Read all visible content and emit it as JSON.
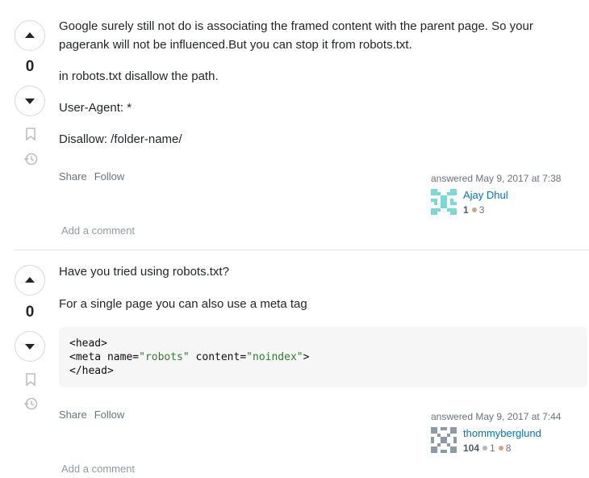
{
  "answers": [
    {
      "vote_count": "0",
      "paragraphs": [
        "Google surely still not do is associating the framed content with the parent page. So your",
        "pagerank will not be influenced.But you can stop it from robots.txt.",
        "in robots.txt disallow the path.",
        "User-Agent: *",
        "Disallow: /folder-name/"
      ],
      "share_label": "Share",
      "follow_label": "Follow",
      "answered_text": "answered May 9, 2017 at 7:38",
      "user_name": "Ajay Dhul",
      "reputation": "1",
      "bronze": "3",
      "add_comment_label": "Add a comment"
    },
    {
      "vote_count": "0",
      "paragraphs": [
        "Have you tried using robots.txt?",
        "For a single page you can also use a meta tag"
      ],
      "code": {
        "line1": "<head>",
        "line2_tag": "<meta name=",
        "line2_name_val": "\"robots\"",
        "line2_attr": " content=",
        "line2_content_val": "\"noindex\"",
        "line2_close": ">",
        "line3": "</head>"
      },
      "share_label": "Share",
      "follow_label": "Follow",
      "answered_text": "answered May 9, 2017 at 7:44",
      "user_name": "thommyberglund",
      "reputation": "104",
      "silver": "1",
      "bronze": "8",
      "add_comment_label": "Add a comment"
    }
  ],
  "icons": {
    "upvote": "arrow-up-icon",
    "downvote": "arrow-down-icon",
    "bookmark": "bookmark-icon",
    "history": "history-icon"
  },
  "colors": {
    "link": "#0074cc",
    "muted": "#6a737c",
    "silver": "#b4b8bc",
    "bronze": "#d1a684"
  }
}
